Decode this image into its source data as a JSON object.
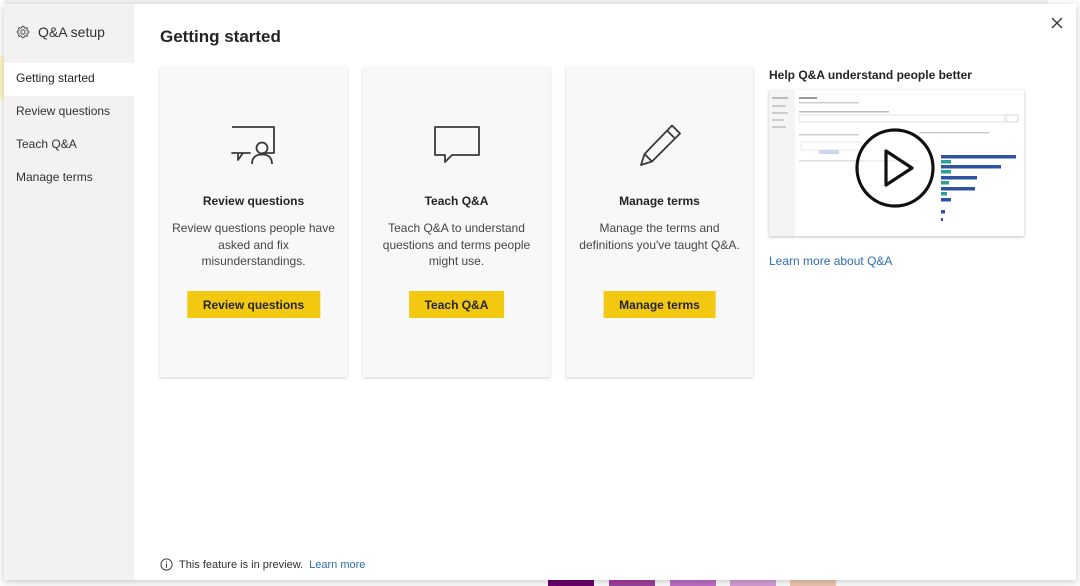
{
  "sidebar": {
    "title": "Q&A setup",
    "items": [
      {
        "label": "Getting started",
        "active": true
      },
      {
        "label": "Review questions",
        "active": false
      },
      {
        "label": "Teach Q&A",
        "active": false
      },
      {
        "label": "Manage terms",
        "active": false
      }
    ]
  },
  "main": {
    "title": "Getting started",
    "cards": [
      {
        "icon": "review-chat-person-icon",
        "title": "Review questions",
        "description": "Review questions people have asked and fix misunderstandings.",
        "button": "Review questions"
      },
      {
        "icon": "speech-bubble-icon",
        "title": "Teach Q&A",
        "description": "Teach Q&A to understand questions and terms people might use.",
        "button": "Teach Q&A"
      },
      {
        "icon": "pencil-icon",
        "title": "Manage terms",
        "description": "Manage the terms and definitions you've taught Q&A.",
        "button": "Manage terms"
      }
    ],
    "help": {
      "title": "Help Q&A understand people better",
      "link": "Learn more about Q&A"
    },
    "footer": {
      "text": "This feature is in preview.",
      "link": "Learn more"
    }
  },
  "colors": {
    "accent": "#f2c811",
    "link": "#2b6fb3",
    "sidebar_bg": "#f3f2f1"
  }
}
